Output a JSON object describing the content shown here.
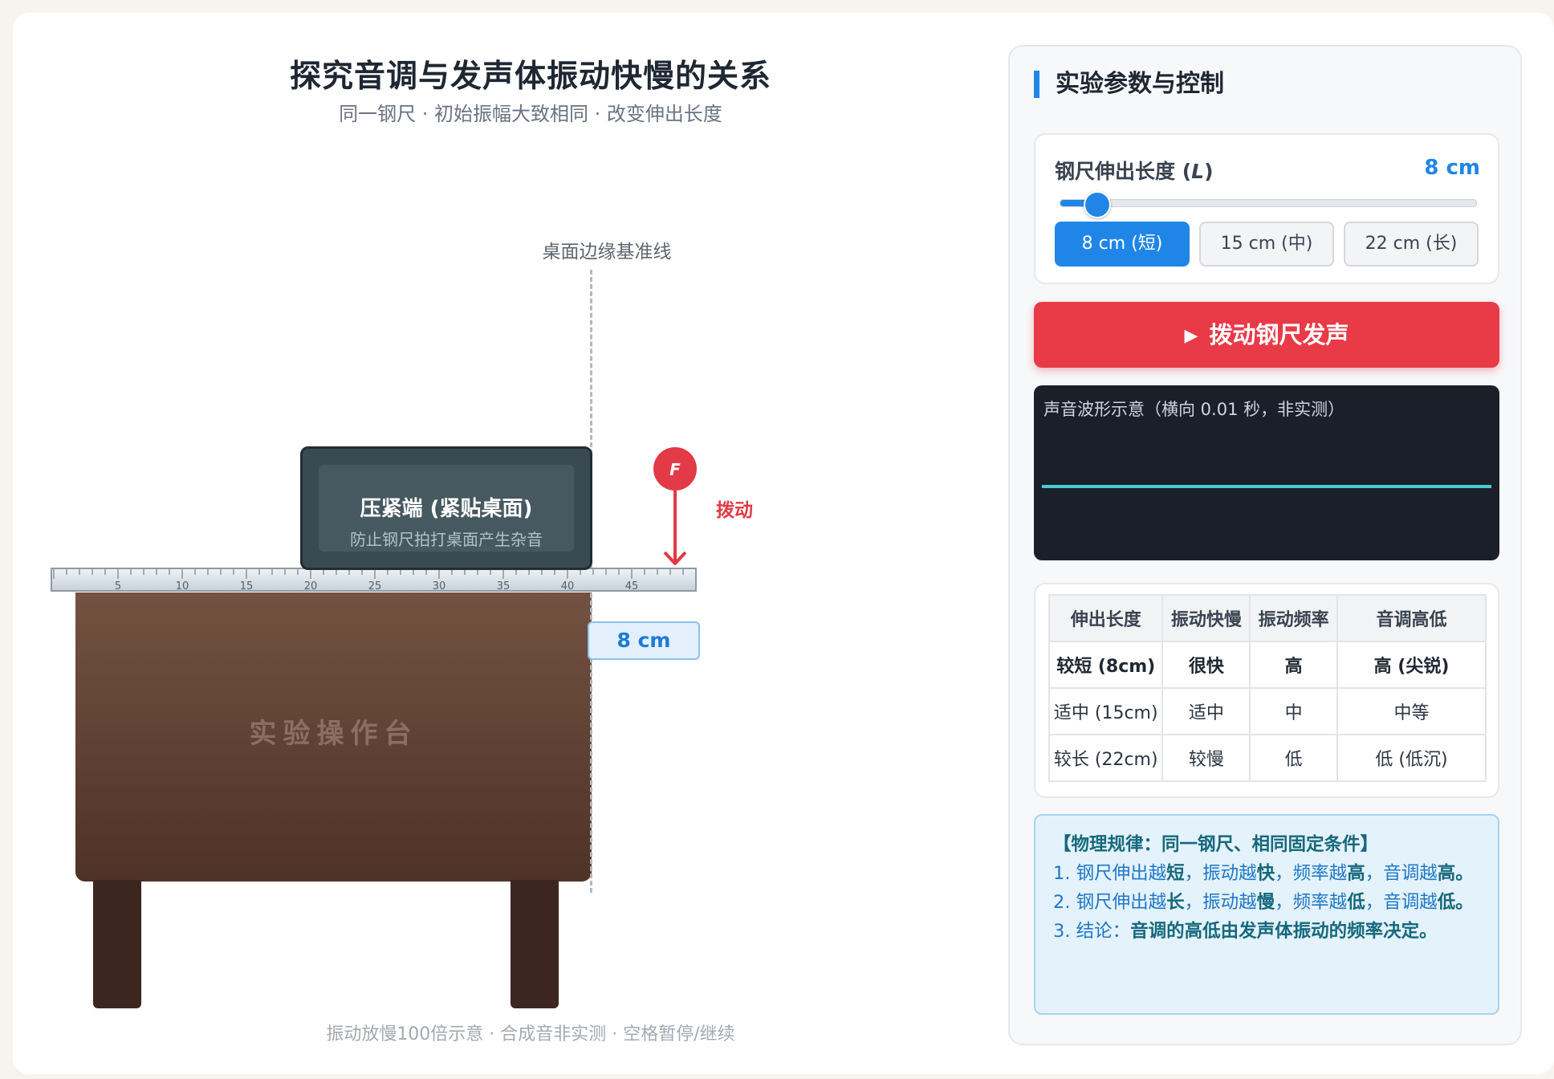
{
  "stage": {
    "title": "探究音调与发声体振动快慢的关系",
    "subtitle": "同一钢尺 · 初始振幅大致相同 · 改变伸出长度",
    "edge_label": "桌面边缘基准线",
    "clamp_title": "压紧端 (紧贴桌面)",
    "clamp_sub": "防止钢尺拍打桌面产生杂音",
    "force_symbol": "F",
    "force_label": "拨动",
    "length_display": "8 cm",
    "table_label": "实验操作台",
    "ruler_ticks": [
      "5",
      "10",
      "15",
      "20",
      "25",
      "30",
      "35",
      "40",
      "45"
    ],
    "footnote": "振动放慢100倍示意 · 合成音非实测 · 空格暂停/继续"
  },
  "panel": {
    "title": "实验参数与控制",
    "length_label_prefix": "钢尺伸出长度 (",
    "length_label_var": "L",
    "length_label_suffix": ")",
    "length_value": "8 cm",
    "slider": {
      "min": 5,
      "max": 40,
      "value": 8
    },
    "presets": [
      {
        "label": "8 cm (短)",
        "active": true
      },
      {
        "label": "15 cm (中)",
        "active": false
      },
      {
        "label": "22 cm (长)",
        "active": false
      }
    ],
    "pluck_button": "拨动钢尺发声",
    "wave_label": "声音波形示意（横向 0.01 秒，非实测）",
    "table": {
      "headers": [
        "伸出长度",
        "振动快慢",
        "振动频率",
        "音调高低"
      ],
      "rows": [
        [
          "较短 (8cm)",
          "很快",
          "高",
          "高 (尖锐)"
        ],
        [
          "适中 (15cm)",
          "适中",
          "中",
          "中等"
        ],
        [
          "较长 (22cm)",
          "较慢",
          "低",
          "低 (低沉)"
        ]
      ],
      "highlight_row": 0
    },
    "law": {
      "heading": "【物理规律：同一钢尺、相同固定条件】",
      "line1": {
        "a": "1. 钢尺伸出越",
        "b": "短",
        "c": "，振动越",
        "d": "快",
        "e": "，频率越",
        "f": "高",
        "g": "，音调越",
        "h": "高。"
      },
      "line2": {
        "a": "2. 钢尺伸出越",
        "b": "长",
        "c": "，振动越",
        "d": "慢",
        "e": "，频率越",
        "f": "低",
        "g": "，音调越",
        "h": "低。"
      },
      "line3": {
        "a": "3. 结论：",
        "b": "音调的高低由发声体振动的频率决定。"
      }
    }
  },
  "colors": {
    "accent": "#1f86e8",
    "danger": "#e83a47",
    "wave": "#4cc9d8"
  }
}
